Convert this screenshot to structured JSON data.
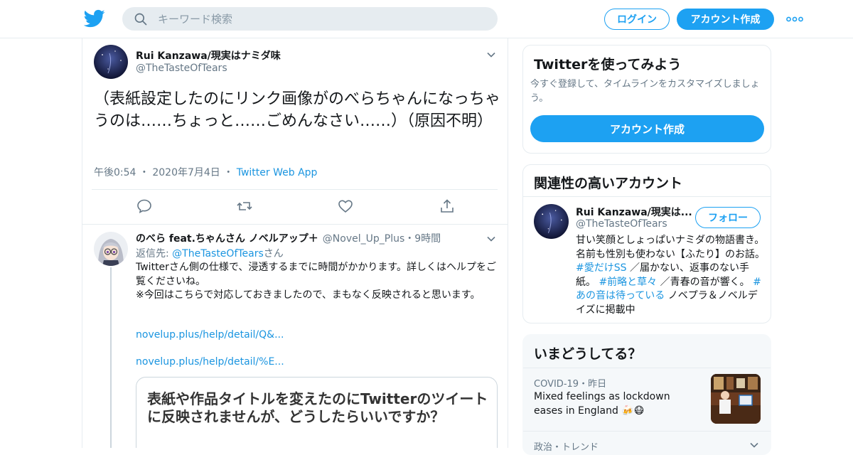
{
  "header": {
    "search_placeholder": "キーワード検索",
    "login_label": "ログイン",
    "signup_label": "アカウント作成"
  },
  "tweet": {
    "name": "Rui Kanzawa/現実はナミダ味",
    "handle": "@TheTasteOfTears",
    "text": "（表紙設定したのにリンク画像がのべらちゃんになっちゃうのは……ちょっと……ごめんなさい……）（原因不明）",
    "time": "午後0:54",
    "date": "2020年7月4日",
    "source": "Twitter Web App"
  },
  "reply": {
    "name": "のべら feat.ちゃんさん ノベルアップ＋",
    "handle": "@Novel_Up_Plus",
    "age": "9時間",
    "reply_to_prefix": "返信先: ",
    "reply_to_handle": "@TheTasteOfTears",
    "reply_to_suffix": "さん",
    "text": "Twitterさん側の仕様で、浸透するまでに時間がかかります。詳しくはヘルプをご覧くださいね。\n※今回はこちらで対応しておきましたので、まもなく反映されると思います。",
    "link1": "novelup.plus/help/detail/Q&...",
    "link2": "novelup.plus/help/detail/%E...",
    "card_title": "表紙や作品タイトルを変えたのにTwitterのツイートに反映されませんが、どうしたらいいですか？"
  },
  "signup_box": {
    "title": "Twitterを使ってみよう",
    "desc": "今すぐ登録して、タイムラインをカスタマイズしましょう。",
    "button": "アカウント作成"
  },
  "related_box": {
    "title": "関連性の高いアカウント",
    "name": "Rui Kanzawa/現実は...",
    "handle": "@TheTasteOfTears",
    "follow": "フォロー",
    "bio_1": "甘い笑顔としょっぱいナミダの物語書き。名前も性別も使わない【ふたり】のお話。 ",
    "tag_1": "#愛だけSS",
    "bio_2": " ／届かない、返事のない手紙。 ",
    "tag_2": "#前略と草々",
    "bio_3": " ／青春の音が響く。 ",
    "tag_3": "#あの音は待っている",
    "bio_4": " ノベプラ＆ノベルデイズに掲載中"
  },
  "trends_box": {
    "title": "いまどうしてる？",
    "meta_topic": "COVID-19",
    "meta_time": "昨日",
    "headline": "Mixed feelings as lockdown eases in England 🍻😷",
    "next_category": "政治・トレンド"
  },
  "colors": {
    "brand": "#1da1f2",
    "link": "#1b95e0",
    "secondary_text": "#657786",
    "border": "#e6ecf0"
  }
}
